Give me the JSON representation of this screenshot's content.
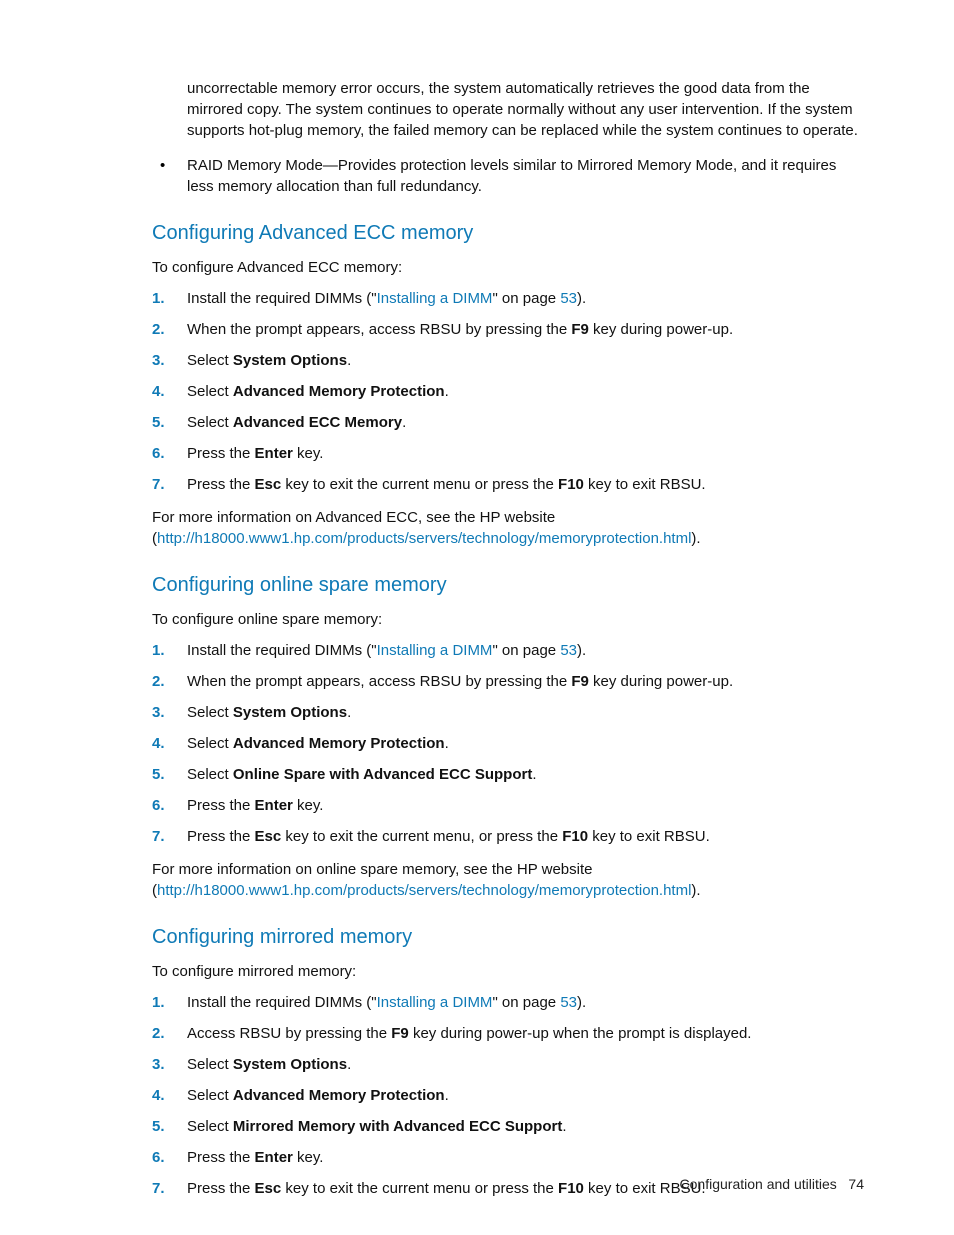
{
  "top_paragraph": "uncorrectable memory error occurs, the system automatically retrieves the good data from the mirrored copy. The system continues to operate normally without any user intervention. If the system supports hot-plug memory, the failed memory can be replaced while the system continues to operate.",
  "bullet_raid": "RAID Memory Mode—Provides protection levels similar to Mirrored Memory Mode, and it requires less memory allocation than full redundancy.",
  "advecc": {
    "heading": "Configuring Advanced ECC memory",
    "intro": "To configure Advanced ECC memory:",
    "steps": {
      "s1_pre": "Install the required DIMMs (\"",
      "s1_link": "Installing a DIMM",
      "s1_mid": "\" on page ",
      "s1_page": "53",
      "s1_post": ").",
      "s2_pre": "When the prompt appears, access RBSU by pressing the ",
      "s2_bold": "F9",
      "s2_post": " key during power-up.",
      "s3_pre": "Select ",
      "s3_bold": "System Options",
      "s3_post": ".",
      "s4_pre": "Select ",
      "s4_bold": "Advanced Memory Protection",
      "s4_post": ".",
      "s5_pre": "Select ",
      "s5_bold": "Advanced ECC Memory",
      "s5_post": ".",
      "s6_pre": "Press the ",
      "s6_bold": "Enter",
      "s6_post": " key.",
      "s7_pre": "Press the ",
      "s7_b1": "Esc",
      "s7_mid": " key to exit the current menu or press the ",
      "s7_b2": "F10",
      "s7_post": " key to exit RBSU."
    },
    "more_pre": "For more information on Advanced ECC, see the HP website (",
    "more_link": "http://h18000.www1.hp.com/products/servers/technology/memoryprotection.html",
    "more_post": ")."
  },
  "spare": {
    "heading": "Configuring online spare memory",
    "intro": "To configure online spare memory:",
    "steps": {
      "s1_pre": "Install the required DIMMs (\"",
      "s1_link": "Installing a DIMM",
      "s1_mid": "\" on page ",
      "s1_page": "53",
      "s1_post": ").",
      "s2_pre": "When the prompt appears, access RBSU by pressing the ",
      "s2_bold": "F9",
      "s2_post": " key during power-up.",
      "s3_pre": "Select ",
      "s3_bold": "System Options",
      "s3_post": ".",
      "s4_pre": "Select ",
      "s4_bold": "Advanced Memory Protection",
      "s4_post": ".",
      "s5_pre": "Select ",
      "s5_bold": "Online Spare with Advanced ECC Support",
      "s5_post": ".",
      "s6_pre": "Press the ",
      "s6_bold": "Enter",
      "s6_post": " key.",
      "s7_pre": "Press the ",
      "s7_b1": "Esc",
      "s7_mid": " key to exit the current menu, or press the ",
      "s7_b2": "F10",
      "s7_post": " key to exit RBSU."
    },
    "more_pre": "For more information on online spare memory, see the HP website (",
    "more_link": "http://h18000.www1.hp.com/products/servers/technology/memoryprotection.html",
    "more_post": ")."
  },
  "mirror": {
    "heading": "Configuring mirrored memory",
    "intro": "To configure mirrored memory:",
    "steps": {
      "s1_pre": "Install the required DIMMs (\"",
      "s1_link": "Installing a DIMM",
      "s1_mid": "\" on page ",
      "s1_page": "53",
      "s1_post": ").",
      "s2_pre": "Access RBSU by pressing the ",
      "s2_bold": "F9",
      "s2_post": " key during power-up when the prompt is displayed.",
      "s3_pre": "Select ",
      "s3_bold": "System Options",
      "s3_post": ".",
      "s4_pre": "Select ",
      "s4_bold": "Advanced Memory Protection",
      "s4_post": ".",
      "s5_pre": "Select ",
      "s5_bold": "Mirrored Memory with Advanced ECC Support",
      "s5_post": ".",
      "s6_pre": "Press the ",
      "s6_bold": "Enter",
      "s6_post": " key.",
      "s7_pre": "Press the ",
      "s7_b1": "Esc",
      "s7_mid": " key to exit the current menu or press the ",
      "s7_b2": "F10",
      "s7_post": " key to exit RBSU."
    }
  },
  "nums": {
    "n1": "1.",
    "n2": "2.",
    "n3": "3.",
    "n4": "4.",
    "n5": "5.",
    "n6": "6.",
    "n7": "7."
  },
  "footer": {
    "section": "Configuration and utilities",
    "page": "74"
  }
}
